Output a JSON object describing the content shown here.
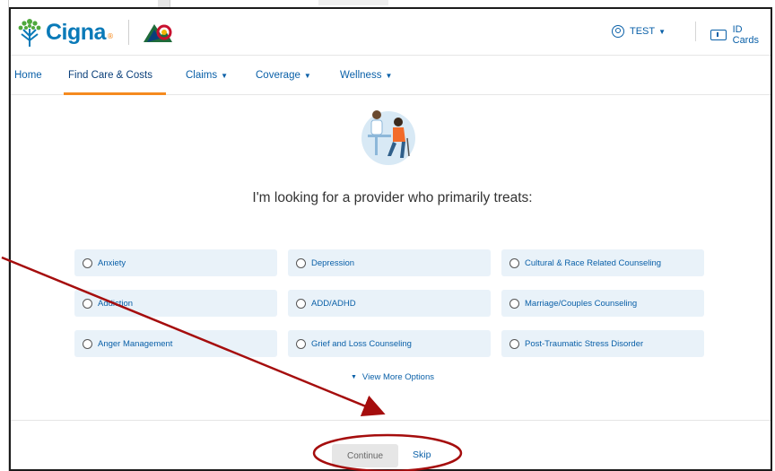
{
  "brand": {
    "name": "Cigna",
    "registered": "®"
  },
  "header": {
    "user_label": "TEST",
    "id_cards_label": "ID Cards"
  },
  "nav": {
    "items": [
      {
        "label": "Home"
      },
      {
        "label": "Find Care & Costs",
        "active": true
      },
      {
        "label": "Claims",
        "dropdown": true
      },
      {
        "label": "Coverage",
        "dropdown": true
      },
      {
        "label": "Wellness",
        "dropdown": true
      }
    ]
  },
  "main": {
    "prompt": "I'm looking for a provider who primarily treats:",
    "options": [
      "Anxiety",
      "Depression",
      "Cultural & Race Related Counseling",
      "Addiction",
      "ADD/ADHD",
      "Marriage/Couples Counseling",
      "Anger Management",
      "Grief and Loss Counseling",
      "Post-Traumatic Stress Disorder"
    ],
    "view_more": "View More Options"
  },
  "footer": {
    "continue_label": "Continue",
    "skip_label": "Skip"
  },
  "icons": {
    "caret": "▼"
  },
  "colors": {
    "brand_blue": "#0a7ab8",
    "link_blue": "#0a60a8",
    "accent_orange": "#f58a1f",
    "tile_bg": "#e9f2f9",
    "annotation_red": "#a50d0d"
  }
}
